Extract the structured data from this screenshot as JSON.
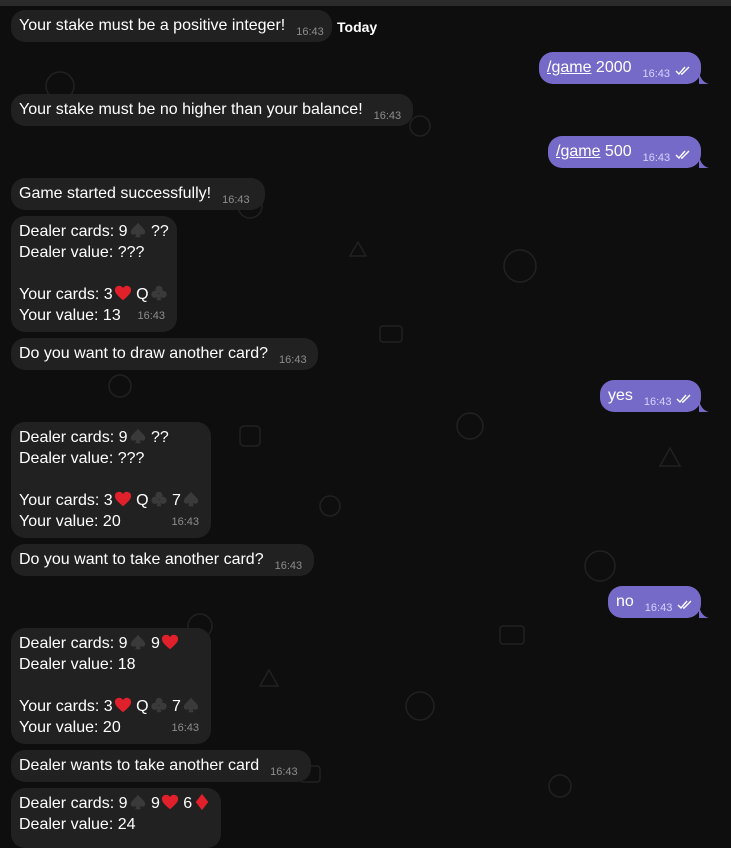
{
  "date_separator": "Today",
  "messages": [
    {
      "text": "Your stake must be a positive integer!",
      "time": "16:43"
    },
    {
      "cmd": "/game",
      "arg": " 2000",
      "time": "16:43"
    },
    {
      "text": "Your stake must be no higher than your balance!",
      "time": "16:43"
    },
    {
      "cmd": "/game",
      "arg": " 500",
      "time": "16:43"
    },
    {
      "text": "Game started successfully!",
      "time": "16:43"
    },
    {
      "dealer_cards_label": "Dealer cards: ",
      "dealer_cards": "9♠ ??",
      "dealer_value": "Dealer value: ???",
      "your_cards_label": "Your cards: ",
      "your_cards": "3♥ Q♣",
      "your_value": "Your value: 13",
      "time": "16:43"
    },
    {
      "text": "Do you want to draw another card?",
      "time": "16:43"
    },
    {
      "text": "yes",
      "time": "16:43"
    },
    {
      "dealer_cards_label": "Dealer cards: ",
      "dealer_cards": "9♠ ??",
      "dealer_value": "Dealer value: ???",
      "your_cards_label": "Your cards: ",
      "your_cards": "3♥ Q♣ 7♠",
      "your_value": "Your value: 20",
      "time": "16:43"
    },
    {
      "text": "Do you want to take another card?",
      "time": "16:43"
    },
    {
      "text": "no",
      "time": "16:43"
    },
    {
      "dealer_cards_label": "Dealer cards: ",
      "dealer_cards": "9♠ 9♥",
      "dealer_value": "Dealer value: 18",
      "your_cards_label": "Your cards: ",
      "your_cards": "3♥ Q♣ 7♠",
      "your_value": "Your value: 20",
      "time": "16:43"
    },
    {
      "text": "Dealer wants to take another card",
      "time": "16:43"
    },
    {
      "dealer_cards_label": "Dealer cards: ",
      "dealer_cards": "9♠ 9♥ 6♦",
      "dealer_value": "Dealer value: 24"
    }
  ],
  "colors": {
    "incoming": "#212121",
    "outgoing": "#766ac8",
    "heart": "#e0202b",
    "spade": "#3a3a3a"
  },
  "icons": {
    "read": "double-check-icon",
    "heart": "heart-suit-icon",
    "spade": "spade-suit-icon",
    "club": "club-suit-icon",
    "diamond": "diamond-suit-icon"
  }
}
